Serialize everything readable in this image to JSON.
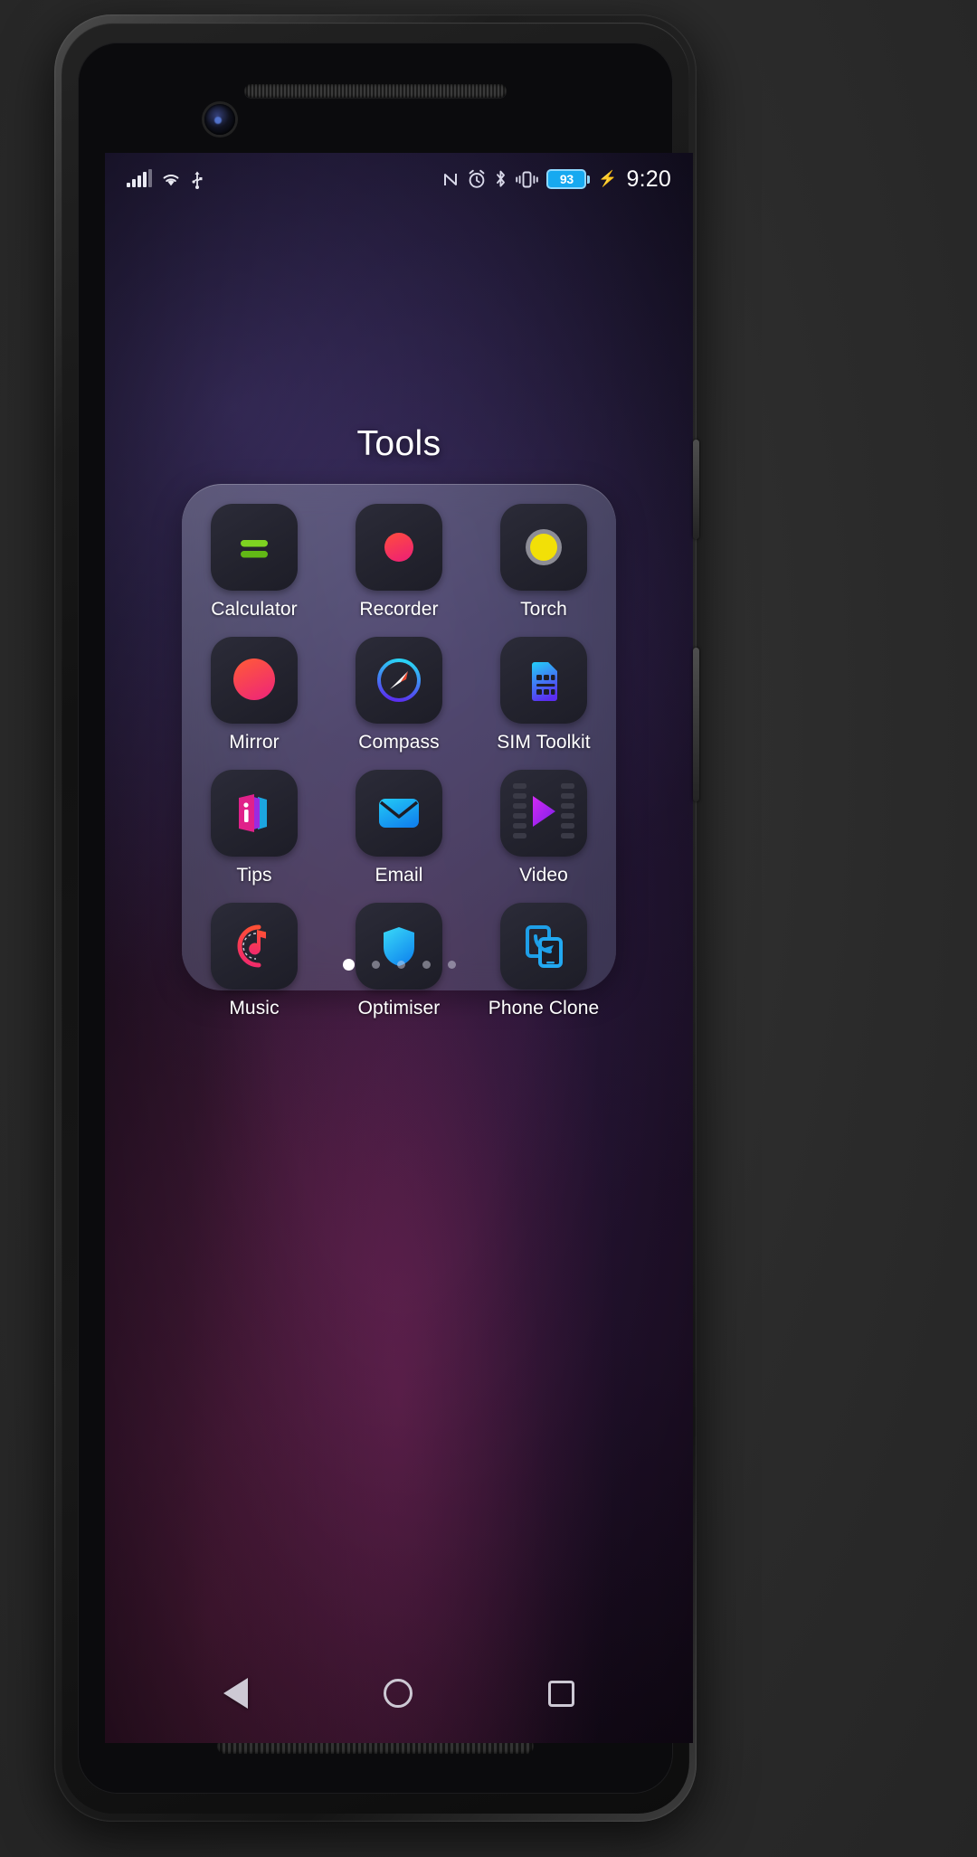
{
  "statusbar": {
    "left_icons": [
      "signal-bars-icon",
      "wifi-icon",
      "usb-icon"
    ],
    "right_icons": [
      "nfc-icon",
      "alarm-icon",
      "bluetooth-icon",
      "vibrate-icon"
    ],
    "battery_level": "93",
    "charging": true,
    "charging_glyph": "⚡",
    "time": "9:20"
  },
  "folder": {
    "title": "Tools",
    "apps": [
      {
        "label": "Calculator",
        "icon": "calculator-icon"
      },
      {
        "label": "Recorder",
        "icon": "recorder-icon"
      },
      {
        "label": "Torch",
        "icon": "torch-icon"
      },
      {
        "label": "Mirror",
        "icon": "mirror-icon"
      },
      {
        "label": "Compass",
        "icon": "compass-icon"
      },
      {
        "label": "SIM Toolkit",
        "icon": "sim-toolkit-icon"
      },
      {
        "label": "Tips",
        "icon": "tips-icon"
      },
      {
        "label": "Email",
        "icon": "email-icon"
      },
      {
        "label": "Video",
        "icon": "video-icon"
      },
      {
        "label": "Music",
        "icon": "music-icon"
      },
      {
        "label": "Optimiser",
        "icon": "optimiser-icon"
      },
      {
        "label": "Phone Clone",
        "icon": "phone-clone-icon"
      }
    ],
    "page_count": 5,
    "active_page": 1
  },
  "navbar": {
    "back": "back-button",
    "home": "home-button",
    "recents": "recents-button"
  },
  "colors": {
    "battery_fill": "#17a9f0",
    "calculator_green": "#7ed321",
    "recorder_red": "#f5484a",
    "torch_yellow": "#f2e007",
    "compass_cyan": "#29c3f5",
    "tips_pink": "#e0218a",
    "email_blue": "#17a9f0",
    "video_purple": "#a226f0",
    "music_red": "#f0434f",
    "optimiser_blue": "#29b6f6",
    "phone_clone_blue": "#1e9fe8"
  }
}
